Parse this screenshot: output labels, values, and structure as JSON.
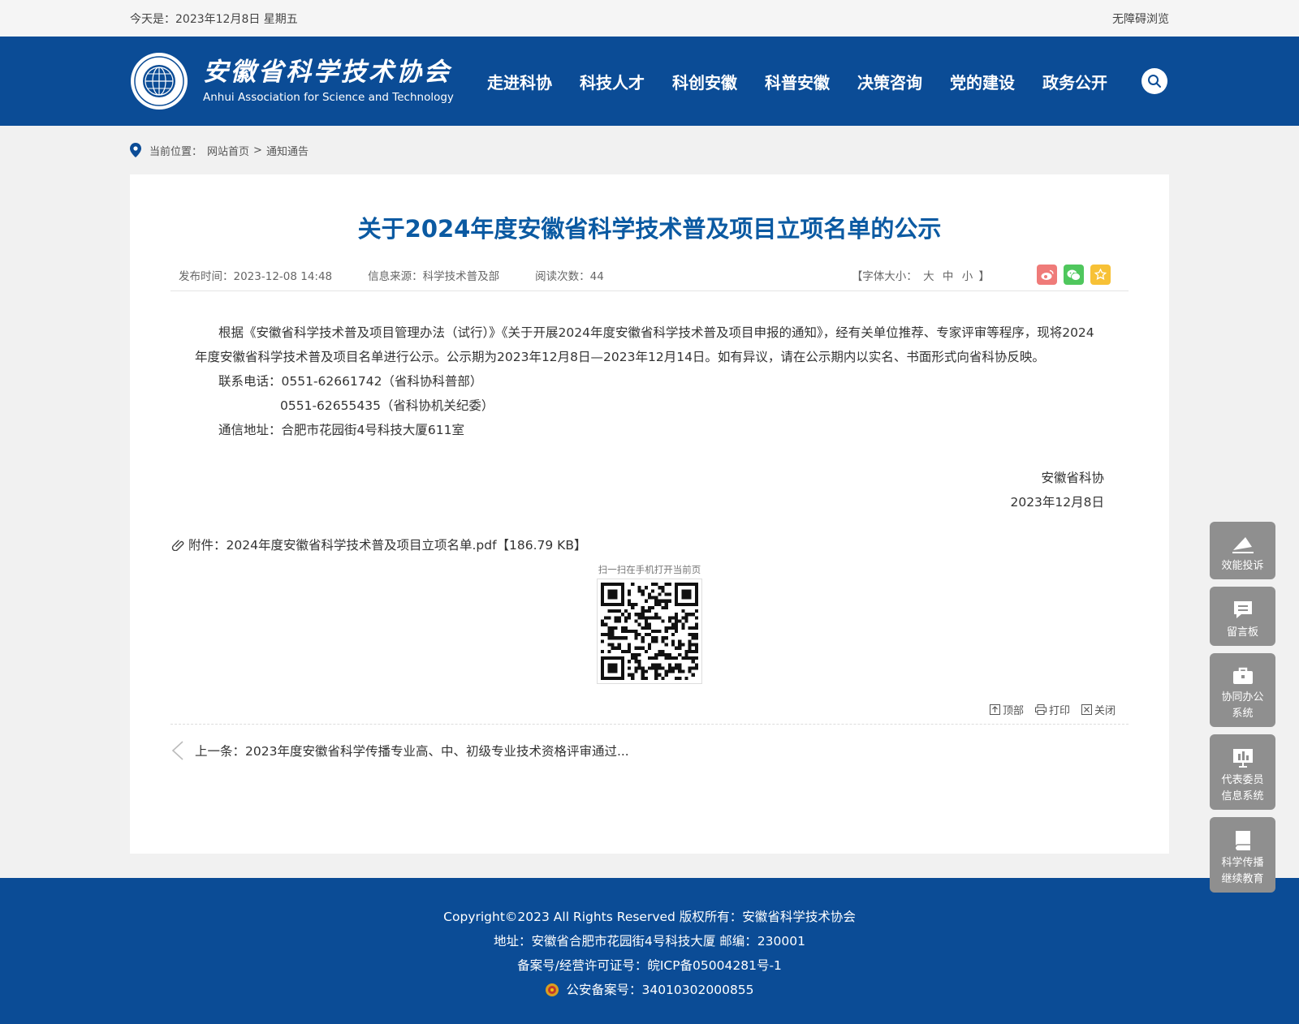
{
  "topbar": {
    "date": "今天是：2023年12月8日 星期五",
    "accessible": "无障碍浏览"
  },
  "header": {
    "logo_cn": "安徽省科学技术协会",
    "logo_en": "Anhui Association for Science and Technology",
    "nav": [
      "走进科协",
      "科技人才",
      "科创安徽",
      "科普安徽",
      "决策咨询",
      "党的建设",
      "政务公开"
    ]
  },
  "breadcrumb": {
    "label": "当前位置：",
    "home": "网站首页",
    "separator": ">",
    "current": "通知通告"
  },
  "article": {
    "title": "关于2024年度安徽省科学技术普及项目立项名单的公示",
    "publish_time": "发布时间：2023-12-08 14:48",
    "source": "信息来源：科学技术普及部",
    "views": "阅读次数：44",
    "font_size_label": "【字体大小：",
    "font_large": "大",
    "font_medium": "中",
    "font_small": "小",
    "font_size_end": "】",
    "paragraph": "根据《安徽省科学技术普及项目管理办法（试行）》《关于开展2024年度安徽省科学技术普及项目申报的通知》，经有关单位推荐、专家评审等程序，现将2024年度安徽省科学技术普及项目名单进行公示。公示期为2023年12月8日—2023年12月14日。如有异议，请在公示期内以实名、书面形式向省科协反映。",
    "phone1": "联系电话：0551-62661742（省科协科普部）",
    "phone2": "0551-62655435（省科协机关纪委）",
    "address": "通信地址：合肥市花园街4号科技大厦611室",
    "signature": "安徽省科协",
    "sign_date": "2023年12月8日",
    "attachment_label": "附件：",
    "attachment_file": "2024年度安徽省科学技术普及项目立项名单.pdf【186.79 KB】",
    "qr_caption": "扫一扫在手机打开当前页",
    "tool_top": "顶部",
    "tool_print": "打印",
    "tool_close": "关闭",
    "prev": "上一条：2023年度安徽省科学传播专业高、中、初级专业技术资格评审通过..."
  },
  "footer": {
    "copyright": "Copyright©2023 All Rights Reserved 版权所有：安徽省科学技术协会",
    "address": "地址：安徽省合肥市花园街4号科技大厦  邮编：230001",
    "icp": "备案号/经营许可证号：皖ICP备05004281号-1",
    "police": "公安备案号：34010302000855"
  },
  "side": [
    {
      "icon": "plane-icon",
      "label1": "效能投诉",
      "label2": ""
    },
    {
      "icon": "message-icon",
      "label1": "留言板",
      "label2": ""
    },
    {
      "icon": "briefcase-icon",
      "label1": "协同办公",
      "label2": "系统"
    },
    {
      "icon": "chart-icon",
      "label1": "代表委员",
      "label2": "信息系统"
    },
    {
      "icon": "book-icon",
      "label1": "科学传播",
      "label2": "继续教育"
    }
  ],
  "colors": {
    "brand": "#0b4c96",
    "title": "#0b5aa2",
    "side_widget": "#8f8f8f"
  }
}
